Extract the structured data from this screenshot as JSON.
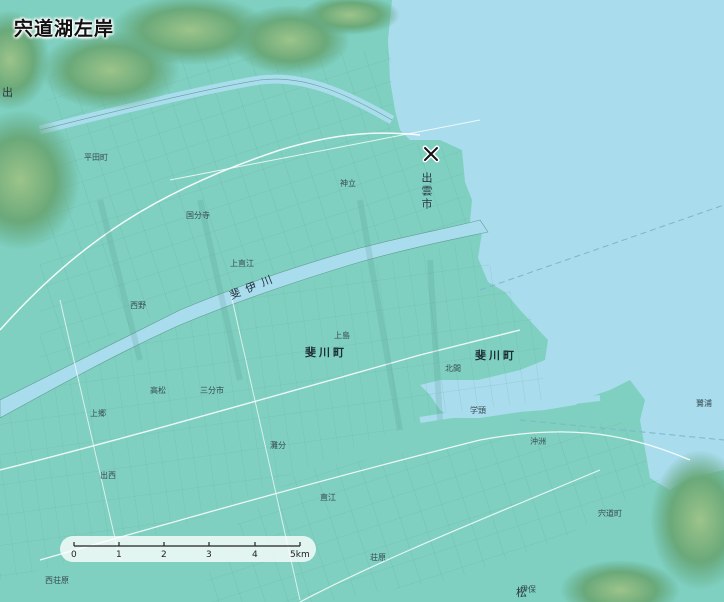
{
  "map": {
    "title": "宍道湖左岸",
    "labels": {
      "izumo_city": "出雲市",
      "hikawa_town_1": "斐川町",
      "hikawa_town_2": "斐川町",
      "hii_river": "斐伊川",
      "hirata": "平田町",
      "idu": "出",
      "matsue": "松",
      "yoshinori_kanda": "宍道町",
      "nishikoto": "西荘原",
      "koharu": "出西",
      "higashi": "直江",
      "ogu": "荘原",
      "taki": "上郷",
      "kokubu": "国分寺",
      "kitama": "北間",
      "okitano": "沖洲",
      "kamishima": "上島",
      "takamatsu": "高松",
      "kizuki": "神立",
      "sono": "三分市",
      "kawaguchi": "灘分",
      "kaminao": "上直江",
      "nishino": "西野",
      "gakutou": "学頭",
      "bukkyo": "伊保",
      "sagi": "鷺浦"
    },
    "scale": {
      "ticks": [
        "0",
        "1",
        "2",
        "3",
        "4",
        "5km"
      ]
    },
    "colors": {
      "water": "#a9dcec",
      "land": "#7fd0c0",
      "hills": "#5fa37a",
      "roads": "#ffffff",
      "rivers": "#a9dcec"
    },
    "icons": {
      "marker": "close-x-icon"
    }
  }
}
